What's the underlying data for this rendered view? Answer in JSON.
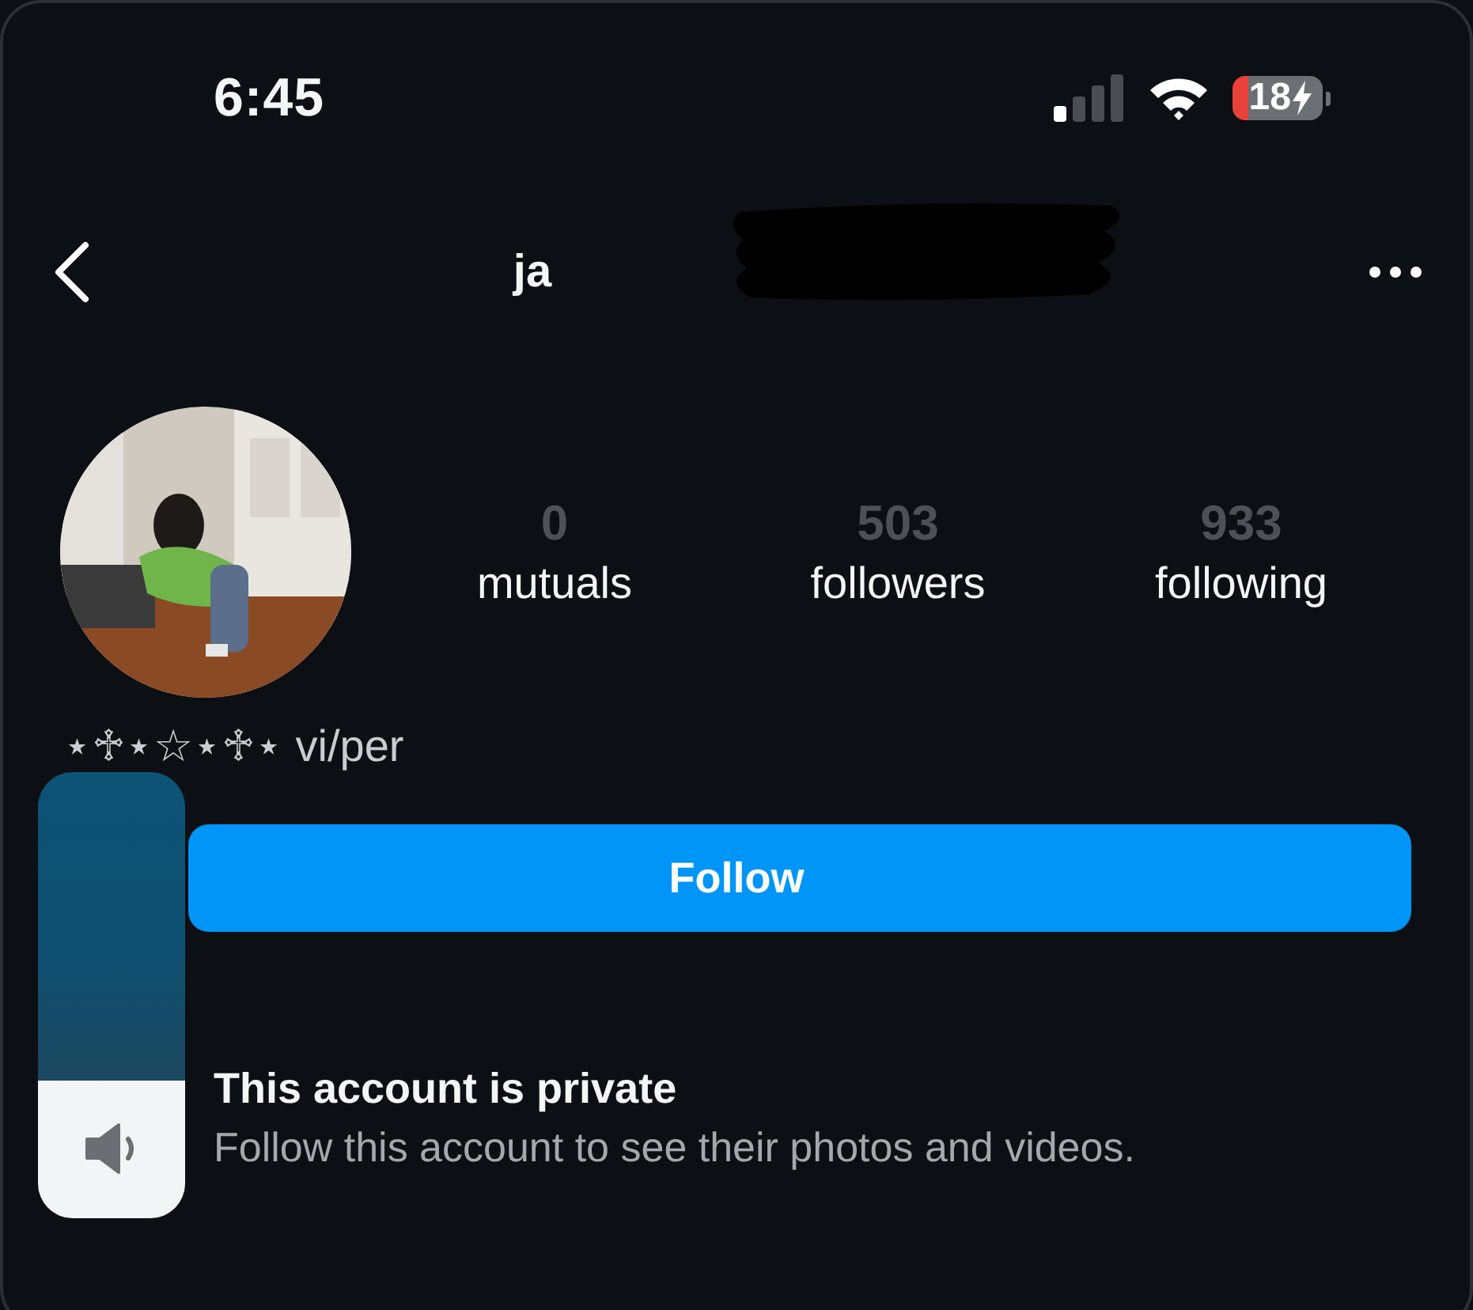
{
  "status_bar": {
    "time": "6:45",
    "battery": "18",
    "charging": true
  },
  "nav": {
    "title": "ja"
  },
  "profile": {
    "stats": [
      {
        "value": "0",
        "label": "mutuals"
      },
      {
        "value": "503",
        "label": "followers"
      },
      {
        "value": "933",
        "label": "following"
      }
    ],
    "bio": "⋆♱⋆☆⋆♱⋆ vi/per"
  },
  "follow_button": {
    "label": "Follow"
  },
  "private_notice": {
    "title": "This account is private",
    "message": "Follow this account to see their photos and videos."
  },
  "volume_hud": {
    "level": 0.31
  }
}
